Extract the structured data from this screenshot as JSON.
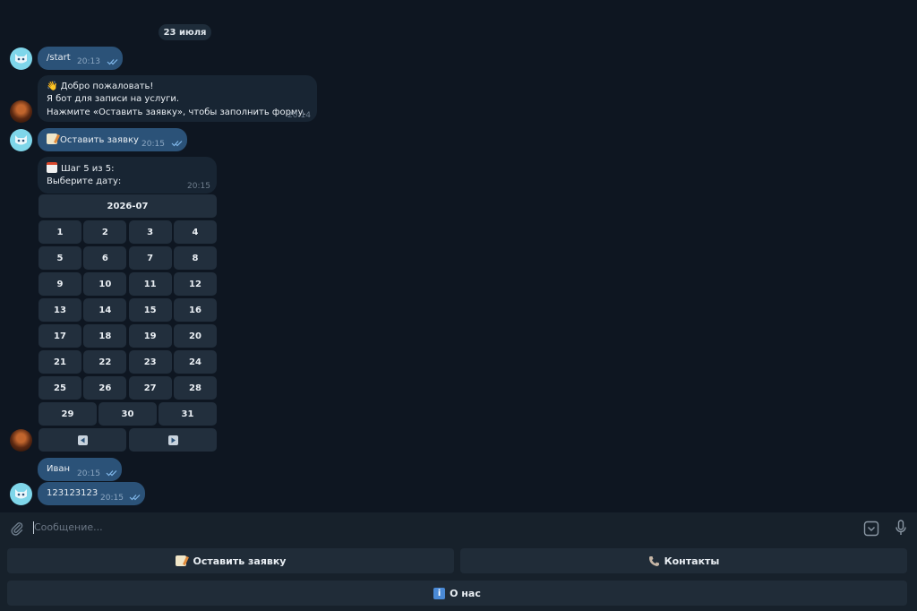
{
  "date_separator": "23 июля",
  "messages": [
    {
      "text": "/start",
      "time": "20:13"
    },
    {
      "line1": "👋 Добро пожаловать!",
      "line2": "Я бот для записи на услуги.",
      "line3": "Нажмите «Оставить заявку», чтобы заполнить форму.",
      "time": "20:14"
    },
    {
      "text": "Оставить заявку",
      "time": "20:15"
    },
    {
      "line1": "Шаг 5 из 5:",
      "line2": "Выберите дату:",
      "time": "20:15"
    },
    {
      "text": "Иван",
      "time": "20:15"
    },
    {
      "text": "123123123",
      "time": "20:15"
    }
  ],
  "calendar": {
    "month": "2026-07",
    "days": [
      "1",
      "2",
      "3",
      "4",
      "5",
      "6",
      "7",
      "8",
      "9",
      "10",
      "11",
      "12",
      "13",
      "14",
      "15",
      "16",
      "17",
      "18",
      "19",
      "20",
      "21",
      "22",
      "23",
      "24",
      "25",
      "26",
      "27",
      "28",
      "29",
      "30",
      "31"
    ]
  },
  "composer": {
    "placeholder": "Сообщение..."
  },
  "reply_keyboard": {
    "btn_request": "Оставить заявку",
    "btn_contacts": "Контакты",
    "btn_about": "О нас"
  },
  "icons": {
    "attach": "paperclip-icon",
    "keyboard": "keyboard-toggle-icon",
    "mic": "microphone-icon",
    "prev": "arrow-left-icon",
    "next": "arrow-right-icon"
  },
  "colors": {
    "background": "#0e1621",
    "outgoing_bubble": "#2b5278",
    "incoming_bubble": "#182533",
    "inline_button": "#222f3d"
  }
}
